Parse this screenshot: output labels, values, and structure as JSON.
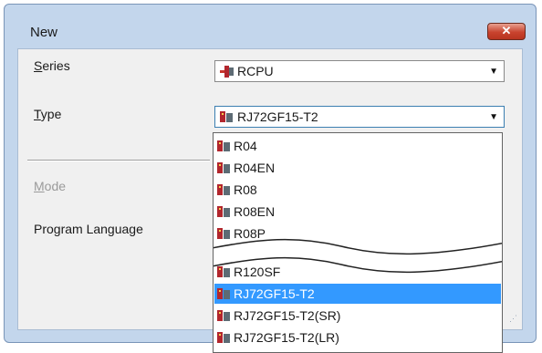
{
  "window": {
    "title": "New",
    "close_label": "✕"
  },
  "series": {
    "label_pre": "",
    "label_key": "S",
    "label_post": "eries",
    "value": "RCPU",
    "icon": "rcpu-series-icon"
  },
  "type": {
    "label_pre": "",
    "label_key": "T",
    "label_post": "ype",
    "value": "RJ72GF15-T2",
    "icon": "cpu-module-icon"
  },
  "mode": {
    "label_pre": "",
    "label_key": "M",
    "label_post": "ode"
  },
  "program_language": {
    "label": "Program Language"
  },
  "dropdown": {
    "items": [
      {
        "label": "R04"
      },
      {
        "label": "R04EN"
      },
      {
        "label": "R08"
      },
      {
        "label": "R08EN"
      },
      {
        "label": "R08P"
      },
      {
        "label": "R120SF"
      },
      {
        "label": "RJ72GF15-T2",
        "selected": true
      },
      {
        "label": "RJ72GF15-T2(SR)"
      },
      {
        "label": "RJ72GF15-T2(LR)"
      }
    ]
  },
  "colors": {
    "selection": "#3399ff",
    "frame": "#c3d6ec",
    "close": "#c8432e"
  }
}
